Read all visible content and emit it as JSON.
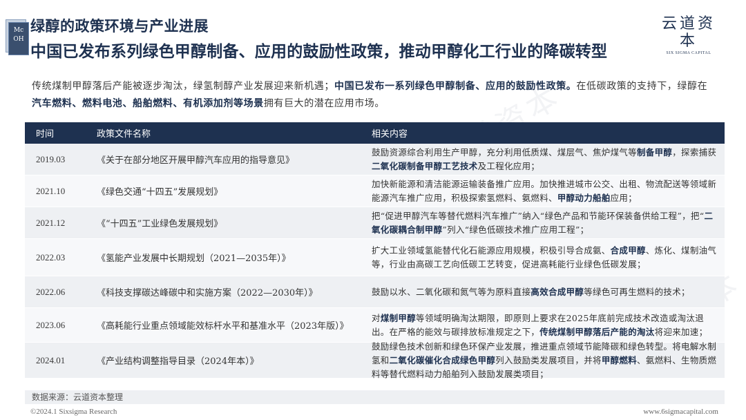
{
  "header": {
    "logo_text_line1": "Mc",
    "logo_text_line2": "OH",
    "supertitle": "绿醇的政策环境与产业进展",
    "title": "中国已发布系列绿色甲醇制备、应用的鼓励性政策，推动甲醇化工行业的降碳转型",
    "brand_cn": "云道资本",
    "brand_en": "SIX SIGMA CAPITAL"
  },
  "intro": {
    "p1": "传统煤制甲醇落后产能被逐步淘汰，绿氢制醇产业发展迎来新机遇；",
    "p1_bold": "中国已发布一系列绿色甲醇制备、应用的鼓励性政策。",
    "p2": "在低碳政策的支持下，绿醇在",
    "p2_bold": "汽车燃料、燃料电池、船舶燃料、有机添加剂等场景",
    "p3": "拥有巨大的潜在应用市场。"
  },
  "table": {
    "headers": [
      "时间",
      "政策文件名称",
      "相关内容"
    ],
    "rows": [
      {
        "date": "2019.03",
        "name": "《关于在部分地区开展甲醇汽车应用的指导意见》",
        "content": [
          {
            "t": "鼓励资源综合利用生产甲醇，充分利用低质煤、煤层气、焦炉煤气等",
            "b": false
          },
          {
            "t": "制备甲醇",
            "b": true
          },
          {
            "t": "，探索捕获",
            "b": false
          },
          {
            "t": "二氧化碳制备甲醇工艺技术",
            "b": true
          },
          {
            "t": "及工程化应用；",
            "b": false
          }
        ]
      },
      {
        "date": "2021.10",
        "name": "《绿色交通“十四五”发展规划》",
        "content": [
          {
            "t": "加快新能源和清洁能源运输装备推广应用。加快推进城市公交、出租、物流配送等领域新能源汽车推广应用，积极探索氢燃料、氨燃料、",
            "b": false
          },
          {
            "t": "甲醇动力船舶",
            "b": true
          },
          {
            "t": "应用；",
            "b": false
          }
        ]
      },
      {
        "date": "2021.12",
        "name": "《“十四五”工业绿色发展规划》",
        "content": [
          {
            "t": "把“促进甲醇汽车等替代燃料汽车推广”纳入“绿色产品和节能环保装备供给工程”，把“",
            "b": false
          },
          {
            "t": "二氧化碳耦合制甲醇",
            "b": true
          },
          {
            "t": "”列入“绿色低碳技术推广应用工程”；",
            "b": false
          }
        ]
      },
      {
        "date": "2022.03",
        "name": "《氢能产业发展中长期规划（2021—2035年）》",
        "content": [
          {
            "t": "扩大工业领域氢能替代化石能源应用规模，积极引导合成氨、",
            "b": false
          },
          {
            "t": "合成甲醇",
            "b": true
          },
          {
            "t": "、炼化、煤制油气等，行业由高碳工艺向低碳工艺转变，促进高耗能行业绿色低碳发展；",
            "b": false
          }
        ]
      },
      {
        "date": "2022.06",
        "name": "《科技支撑碳达峰碳中和实施方案（2022—2030年）》",
        "content": [
          {
            "t": "鼓励以水、二氧化碳和氮气等为原料直接",
            "b": false
          },
          {
            "t": "高效合成甲醇",
            "b": true
          },
          {
            "t": "等绿色可再生燃料的技术；",
            "b": false
          }
        ]
      },
      {
        "date": "2023.06",
        "name": "《高耗能行业重点领域能效标杆水平和基准水平（2023年版）》",
        "content": [
          {
            "t": "对",
            "b": false
          },
          {
            "t": "煤制甲醇",
            "b": true
          },
          {
            "t": "等领域明确淘汰期限，即原则上要求在2025年底前完成技术改造或淘汰退出。在严格的能效与碳排放标准规定之下，",
            "b": false
          },
          {
            "t": "传统煤制甲醇落后产能的淘汰",
            "b": true
          },
          {
            "t": "将迎来加速；",
            "b": false
          }
        ]
      },
      {
        "date": "2024.01",
        "name": "《产业结构调整指导目录（2024年本）》",
        "content": [
          {
            "t": "鼓励绿色技术创新和绿色环保产业发展，推进重点领域节能降碳和绿色转型。将电解水制氢和",
            "b": false
          },
          {
            "t": "二氧化碳催化合成绿色甲醇",
            "b": true
          },
          {
            "t": "列入鼓励类发展项目，并将",
            "b": false
          },
          {
            "t": "甲醇燃料",
            "b": true
          },
          {
            "t": "、氨燃料、生物质燃料等替代燃料动力船舶列入鼓励发展类项目；",
            "b": false
          }
        ]
      }
    ]
  },
  "source": "数据来源：云道资本整理",
  "footer": {
    "left": "©2024.1 Sixsigma Research",
    "right": "www.6sigmacapital.com"
  },
  "colors": {
    "navy": "#1e3150",
    "row_a": "#eef0f3",
    "row_b": "#f7f8fa"
  }
}
